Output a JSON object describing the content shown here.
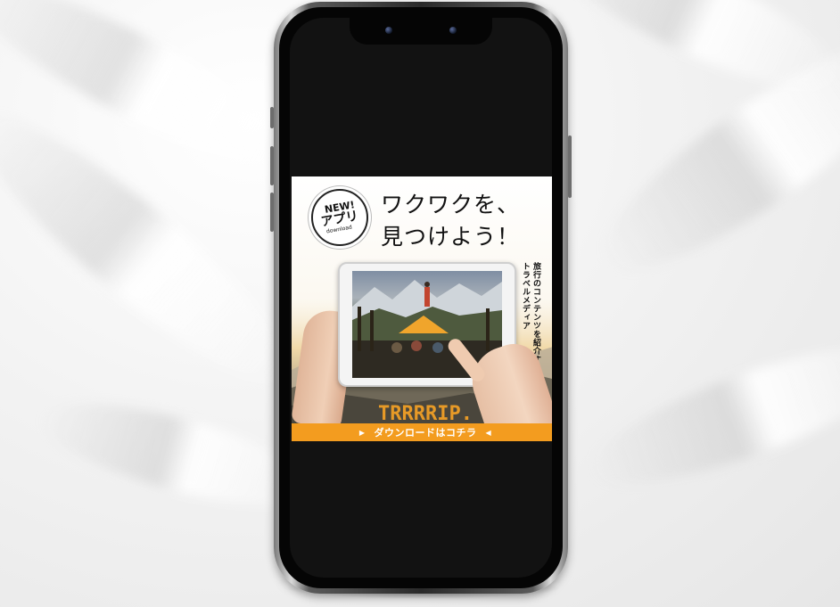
{
  "ad": {
    "badge": {
      "new": "NEW!",
      "app": "アプリ",
      "download": "download"
    },
    "headline": {
      "line1": "ワクワクを、",
      "line2": "見つけよう！"
    },
    "vertical_text": {
      "line1": "旅行のコンテンツを紹介する",
      "line2": "トラベルメディア"
    },
    "brand": "TRRRRIP.",
    "cta": {
      "label": "ダウンロードはコチラ",
      "left_icon": "play-right-icon",
      "right_icon": "play-left-icon"
    },
    "colors": {
      "accent": "#f39c1f",
      "brand": "#e79a27"
    }
  }
}
